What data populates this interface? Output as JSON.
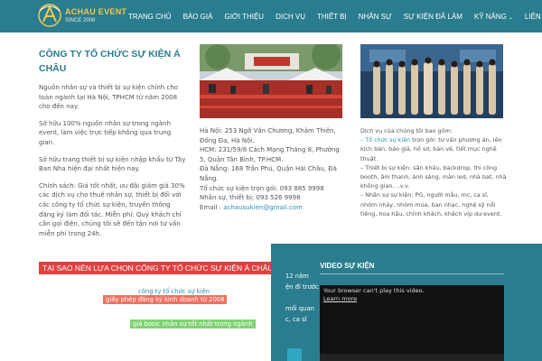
{
  "brand": {
    "name": "ACHAU EVENT",
    "since": "SINCE 2008",
    "colors": {
      "primary": "#2a7d8e",
      "accent": "#e04040",
      "gold": "#f0c850",
      "link": "#2a8fb0"
    }
  },
  "nav": {
    "items": [
      {
        "label": "TRANG CHỦ"
      },
      {
        "label": "BÁO GIÁ"
      },
      {
        "label": "GIỚI THIỆU"
      },
      {
        "label": "DỊCH VỤ"
      },
      {
        "label": "THIẾT BỊ"
      },
      {
        "label": "NHÂN SỰ"
      },
      {
        "label": "SỰ KIỆN ĐÃ LÀM"
      },
      {
        "label": "KỸ NĂNG",
        "caret": "⌄"
      },
      {
        "label": "LIÊN HỆ"
      }
    ]
  },
  "about": {
    "title": "CÔNG TY TỔ CHỨC SỰ KIỆN Á CHÂU",
    "paragraphs": [
      "Nguồn nhân sự và thiết bị sự kiện chính cho toàn ngành tại Hà Nội, TPHCM từ năm 2008 cho đến nay.",
      "Sở hữu 100% nguồn nhân sự trong ngành event, làm việc trực tiếp không qua trung gian.",
      "Sở hữu trang thiết bị sự kiện nhập khẩu từ Tây Ban Nha hiện đại nhất hiện nay.",
      "Chính sách: Giá tốt nhất, ưu đãi giảm giá 30% các dịch vụ cho thuê nhân sự, thiết bị đối với các công ty tổ chức sự kiện, truyền thông đăng ký làm đối tác. Miễn phí: Quý khách chỉ cần gọi điện, chúng tôi sẽ đến tận nơi tư vấn miễn phí trong 24h."
    ]
  },
  "contact": {
    "hanoi": "Hà Nội: 253 Ngõ Văn Chương, Khâm Thiên, Đống Đa, Hà Nội.",
    "hcm": "HCM: 231/59/8 Cách Mạng Tháng 8, Phường 5, Quận Tân Bình, TP.HCM.",
    "danang": "Đà Nẵng: 168 Trần Phú, Quận Hải Châu, Đà Nẵng.",
    "event_phone": "Tổ chức sự kiện trọn gói: 093 885 9998",
    "staff_phone": "Nhân sự, thiết bị: 093 526 9998",
    "email_label": "Email : ",
    "email": "achausukien@gmail.com"
  },
  "services": {
    "intro": "Dịch vụ của chúng tôi bao gồm:",
    "item1_link": "– Tổ chức sự kiện",
    "item1_rest": " trọn gói: tư vấn phương án, lên kịch bản, báo giá, hồ sơ, bản vẽ, tiết mục nghệ thuật.",
    "item2": "– Thiết bị sự kiện: sân khấu, backdrop, thi công booth, âm thanh, ánh sáng, màn led, nhà bạt, nhà không gian, ..v.v.",
    "item3": "– Nhân sự sự kiện: PG, người mẫu, mc, ca sĩ, nhóm nhảy, nhóm múa, ban nhạc, nghệ sỹ nổi tiếng, hoa hậu, chính khách, khách vip dự event."
  },
  "why": {
    "title": "TẠI SAO NÊN LỰA CHỌN CÔNG TY TỔ CHỨC SỰ KIỆN Á CHÂU?",
    "tag1": "công ty tổ chức sự kiện",
    "tag2": "giấy phép đăng ký kinh doanh từ 2008",
    "tag3": "giá bosic nhân sự tốt nhất trong ngành",
    "side_lines": [
      "12 năm",
      "ện đi trước",
      "",
      "mối quan",
      "c, ca sĩ"
    ]
  },
  "video": {
    "title": "VIDEO SỰ KIỆN",
    "message": "Your browser can't play this video.",
    "link": "Learn more"
  }
}
